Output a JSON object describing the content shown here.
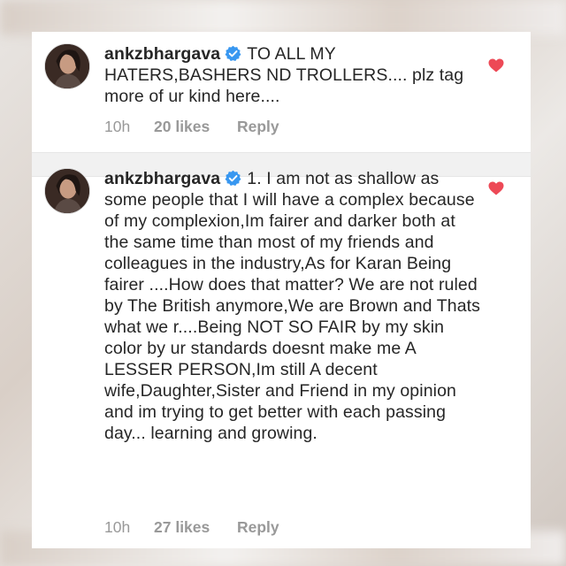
{
  "comments": [
    {
      "username": "ankzbhargava",
      "text": "TO ALL MY HATERS,BASHERS ND TROLLERS.... plz tag more of ur kind here....",
      "time": "10h",
      "likes": "20 likes",
      "reply": "Reply",
      "liked": true
    },
    {
      "username": "ankzbhargava",
      "text": "1. I am not as shallow as some people that I will have a complex because of my complexion,Im fairer and darker both at the same time than most of my friends and colleagues in the industry,As for Karan Being fairer ....How does that matter? We are not ruled by The British anymore,We are Brown and Thats what we r....Being NOT SO FAIR by my skin color by ur standards doesnt make me A LESSER PERSON,Im still A decent wife,Daughter,Sister and Friend in my opinion and im trying to get better with each passing day... learning and growing.",
      "time": "10h",
      "likes": "27 likes",
      "reply": "Reply",
      "liked": true
    }
  ],
  "colors": {
    "verified": "#3897f0",
    "heart": "#ed4956",
    "meta": "#999999",
    "text": "#262626"
  },
  "icons": {
    "verified": "verified-badge-icon",
    "like": "heart-icon"
  }
}
